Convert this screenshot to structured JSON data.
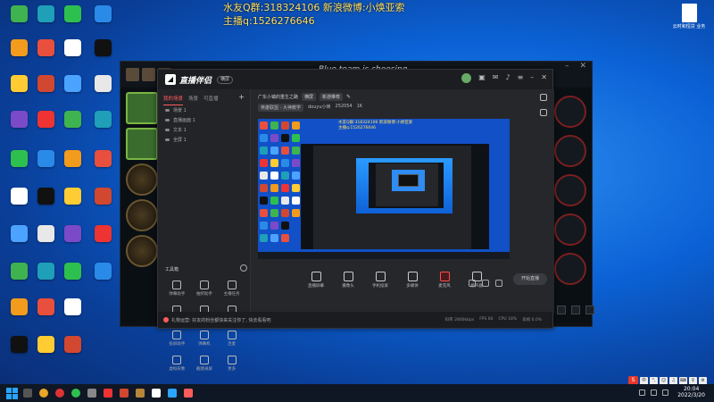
{
  "overlay": {
    "line1": "水友Q群:318324106 新浪微博:小焕亚索",
    "line2": "主播q:1526276646"
  },
  "desktop": {
    "right_icon_label": "云时和恒贷 业务"
  },
  "game": {
    "status_title": "Blue team is choosing"
  },
  "stream_app": {
    "name": "直播伴侣",
    "tabs": [
      "我的场景",
      "场景",
      "可直播"
    ],
    "scenes": [
      "场景 1",
      "直播画面 1",
      "文本 1",
      "全屏 1"
    ],
    "room_title": "广东小镇的重生之路",
    "live_mode": "横屏",
    "mode": "横屏",
    "room_category": "新游推荐",
    "channel_name": "英雄联盟 - 大神教学",
    "platform_id": "douyu小焕",
    "room_number": "252054",
    "viewers": "1K",
    "tools_section": "工具箱",
    "tools": [
      "弹幕助手",
      "抽奖助手",
      "主播任务",
      "粉丝团",
      "礼物管理",
      "精彩时刻",
      "投屏助手",
      "弹幕机",
      "连麦",
      "虚拟形象",
      "截图录屏",
      "更多"
    ],
    "bottom_tools": [
      "直播屏幕",
      "摄像头",
      "手机投屏",
      "多媒体",
      "麦克风",
      "扬声器"
    ],
    "start_button": "开始直播",
    "status_tip": "礼物运营: 好友的粉丝都快来关注你了, 快去看看吧",
    "stats": [
      "码率 2800kbps",
      "FPS 60",
      "CPU 18%",
      "丢帧 0.0%"
    ]
  },
  "preview": {
    "overlay_line1": "水友Q群:318324106 新浪微博:小焕亚索",
    "overlay_line2": "主播q:1526276646",
    "inner_title": "Blue team is choosing"
  },
  "ime": {
    "logo": "S",
    "items": [
      "中",
      "°,",
      "☺",
      "♫",
      "⌨",
      "♀",
      "⚙"
    ]
  },
  "taskbar": {
    "time": "20:04",
    "date": "2022/3/20"
  },
  "colors": {
    "overlay_text": "#ffe066",
    "accent": "#ff5c5c",
    "desktop_blue": "#0b62d6"
  },
  "icons": {
    "desktop": [
      "tv-app-icon",
      "tool-icon",
      "qq-icon",
      "doc-icon",
      "browser-icon",
      "game-icon",
      "shield-icon",
      "chat-icon",
      "nvidia-icon",
      "folder-icon",
      "ie-icon",
      "steam-icon",
      "chrome-icon",
      "settings-icon"
    ]
  }
}
